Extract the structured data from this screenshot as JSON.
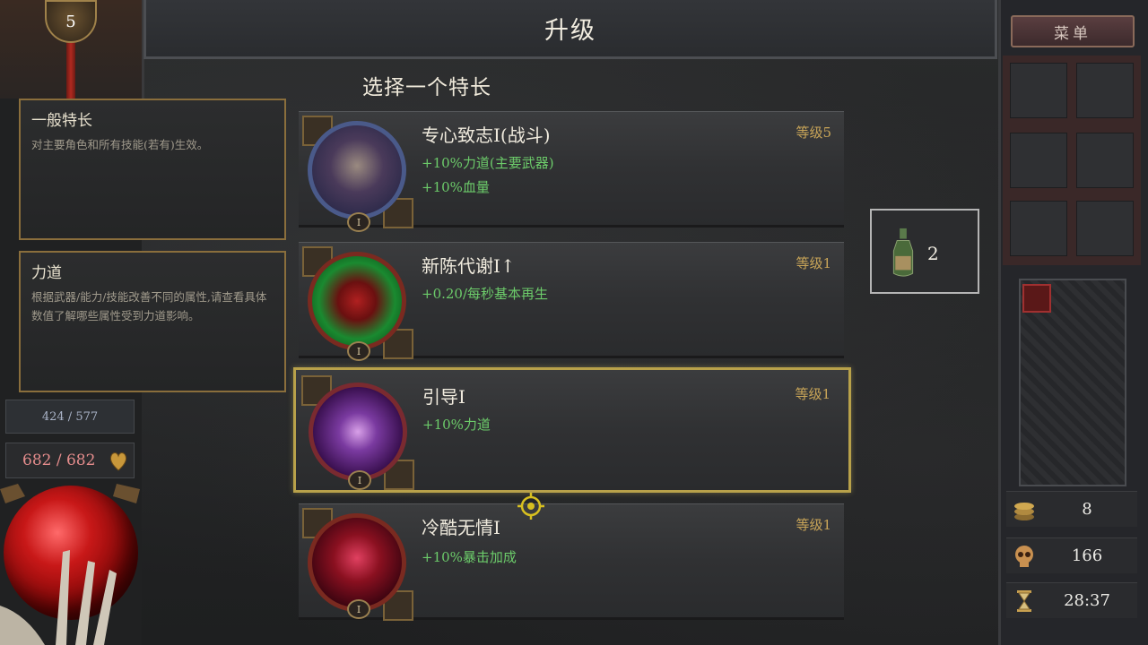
{
  "player": {
    "level": "5",
    "xp": "424 / 577",
    "hp": "682 / 682"
  },
  "header": {
    "title": "升级",
    "subtitle": "选择一个特长"
  },
  "info_panels": [
    {
      "title": "一般特长",
      "desc": "对主要角色和所有技能(若有)生效。"
    },
    {
      "title": "力道",
      "desc": "根据武器/能力/技能改善不同的属性,请查看具体数值了解哪些属性受到力道影响。"
    }
  ],
  "talents": [
    {
      "name": "专心致志I(战斗)",
      "level": "等级5",
      "effects": [
        "+10%力道(主要武器)",
        "+10%血量"
      ],
      "rank": "I",
      "icon": "warrior-portrait-icon",
      "color": "#2a3a6a"
    },
    {
      "name": "新陈代谢I↑",
      "level": "等级1",
      "effects": [
        "+0.20/每秒基本再生"
      ],
      "rank": "I",
      "icon": "lungs-icon",
      "color": "#1f6a2a"
    },
    {
      "name": "引导I",
      "level": "等级1",
      "effects": [
        "+10%力道"
      ],
      "rank": "I",
      "icon": "meditating-figure-icon",
      "color": "#5a1f7a"
    },
    {
      "name": "冷酷无情I",
      "level": "等级1",
      "effects": [
        "+10%暴击加成"
      ],
      "rank": "I",
      "icon": "bleeding-claw-icon",
      "color": "#7a1020"
    }
  ],
  "potion": {
    "count": "2",
    "icon": "potion-bottle-icon"
  },
  "menu": {
    "label": "菜单"
  },
  "stats": [
    {
      "icon": "gold-coins-icon",
      "value": "8"
    },
    {
      "icon": "skull-icon",
      "value": "166"
    },
    {
      "icon": "hourglass-icon",
      "value": "28:37"
    }
  ],
  "colors": {
    "accent_gold": "#b8a14a",
    "effect_green": "#6ccb6a",
    "level_gold": "#c9a558",
    "health_red": "#c81818"
  }
}
